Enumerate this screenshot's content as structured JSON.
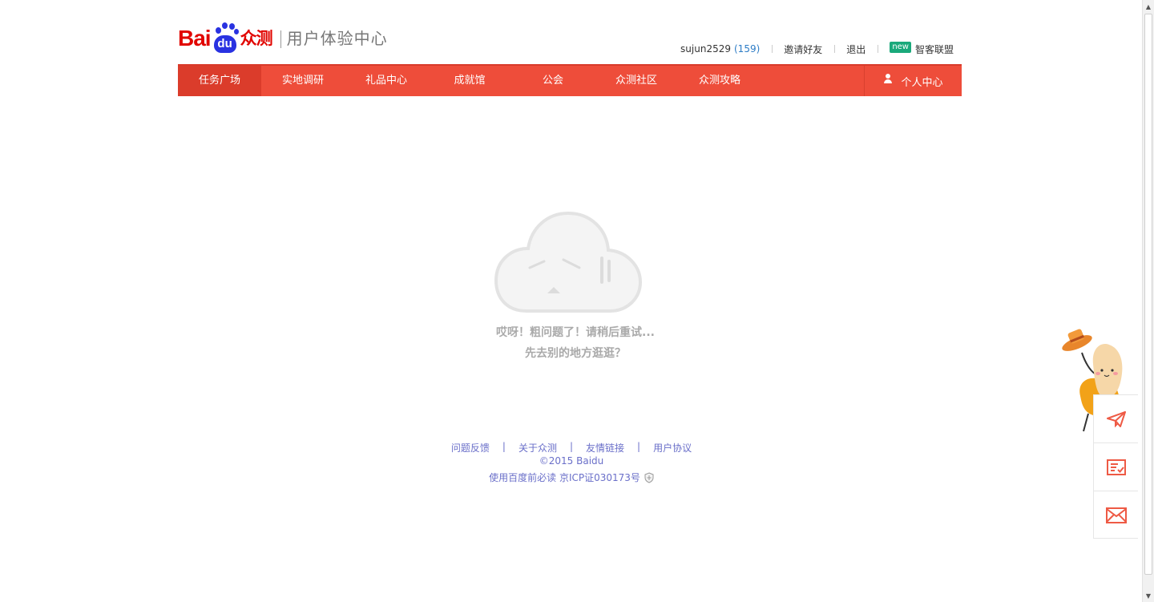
{
  "header": {
    "logo_bai": "Bai",
    "logo_du": "du",
    "logo_zhongce": "众测",
    "logo_subtitle": "用户体验中心",
    "username": "sujun2529",
    "points": "(159)",
    "invite_label": "邀请好友",
    "logout_label": "退出",
    "new_badge": "new",
    "alliance_label": "智客联盟"
  },
  "nav": {
    "items": [
      {
        "label": "任务广场"
      },
      {
        "label": "实地调研"
      },
      {
        "label": "礼品中心"
      },
      {
        "label": "成就馆"
      },
      {
        "label": "公会"
      },
      {
        "label": "众测社区"
      },
      {
        "label": "众测攻略"
      }
    ],
    "personal_center": "个人中心"
  },
  "error": {
    "line1": "哎呀！粗问题了！请稍后重试...",
    "line2": "先去别的地方逛逛？"
  },
  "footer": {
    "links": [
      "问题反馈",
      "关于众测",
      "友情链接",
      "用户协议"
    ],
    "separator": "|",
    "copyright": "©2015 Baidu",
    "must_read": "使用百度前必读",
    "icp": "京ICP证030173号"
  },
  "colors": {
    "nav_bg": "#ee4d3a",
    "nav_active": "#db3c2b",
    "brand_red": "#e10601",
    "brand_blue": "#2932e1",
    "footer_link": "#6a6fc9",
    "widget_icon": "#ee5a45"
  },
  "icons": {
    "cloud": "sad-cloud-icon",
    "user": "user-icon",
    "send": "paper-plane-icon",
    "survey": "checklist-icon",
    "mail": "mail-icon",
    "shield": "shield-icon"
  }
}
